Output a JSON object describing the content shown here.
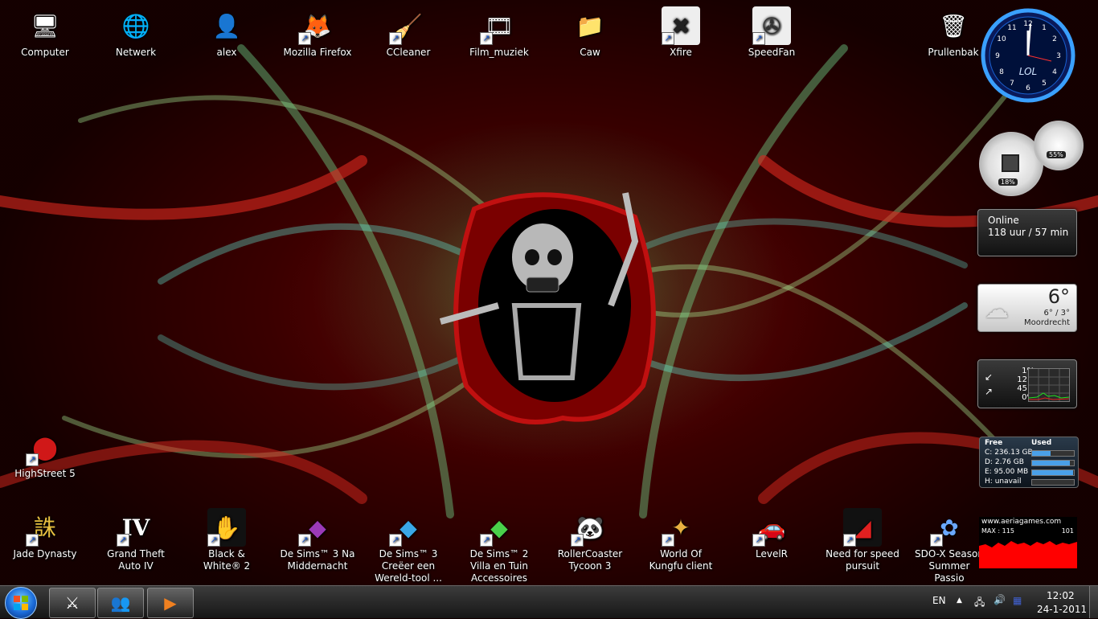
{
  "desktop": {
    "top_icons": [
      {
        "label": "Computer",
        "icon": "computer-icon",
        "glyph": "🖥",
        "shortcut": false
      },
      {
        "label": "Netwerk",
        "icon": "network-icon",
        "glyph": "🌐",
        "shortcut": false
      },
      {
        "label": "alex",
        "icon": "user-folder-icon",
        "glyph": "👤",
        "shortcut": false
      },
      {
        "label": "Mozilla Firefox",
        "icon": "firefox-icon",
        "glyph": "🦊",
        "shortcut": true
      },
      {
        "label": "CCleaner",
        "icon": "ccleaner-icon",
        "glyph": "🧹",
        "shortcut": true
      },
      {
        "label": "Film_muziek",
        "icon": "film-folder-icon",
        "glyph": "🎞",
        "shortcut": true
      },
      {
        "label": "Caw",
        "icon": "folder-icon",
        "glyph": "📁",
        "shortcut": false
      },
      {
        "label": "Xfire",
        "icon": "xfire-icon",
        "glyph": "✖",
        "shortcut": true
      },
      {
        "label": "SpeedFan",
        "icon": "speedfan-icon",
        "glyph": "✇",
        "shortcut": true
      },
      {
        "label": "Prullenbak",
        "icon": "recycle-bin-icon",
        "glyph": "🗑",
        "shortcut": false
      }
    ],
    "side_icon": {
      "label": "HighStreet 5",
      "icon": "highstreet-icon",
      "glyph": "⬤",
      "shortcut": true
    },
    "bottom_icons": [
      {
        "label": "Jade Dynasty",
        "icon": "jade-dynasty-icon",
        "glyph": "誅",
        "shortcut": true
      },
      {
        "label": "Grand Theft Auto IV",
        "icon": "gta-iv-icon",
        "glyph": "IV",
        "shortcut": true
      },
      {
        "label": "Black & White® 2",
        "icon": "black-white-2-icon",
        "glyph": "✋",
        "shortcut": true
      },
      {
        "label": "De Sims™ 3 Na Middernacht",
        "icon": "sims-3-night-icon",
        "glyph": "◆",
        "shortcut": true
      },
      {
        "label": "De Sims™ 3 Creëer een Wereld-tool ...",
        "icon": "sims-3-create-world-icon",
        "glyph": "◆",
        "shortcut": true
      },
      {
        "label": "De Sims™ 2 Villa en Tuin Accessoires",
        "icon": "sims-2-villa-icon",
        "glyph": "◆",
        "shortcut": true
      },
      {
        "label": "RollerCoaster Tycoon 3",
        "icon": "rollercoaster-icon",
        "glyph": "🐼",
        "shortcut": true
      },
      {
        "label": "World Of Kungfu client",
        "icon": "kungfu-icon",
        "glyph": "✦",
        "shortcut": true
      },
      {
        "label": "LevelR",
        "icon": "levelr-icon",
        "glyph": "🚗",
        "shortcut": true
      },
      {
        "label": "Need for speed pursuit",
        "icon": "nfs-icon",
        "glyph": "◢",
        "shortcut": true
      },
      {
        "label": "SDO-X Season Summer Passio",
        "icon": "sdo-x-icon",
        "glyph": "✿",
        "shortcut": true
      }
    ]
  },
  "gadgets": {
    "clock": {
      "label": "LOL",
      "hour_hand": 12,
      "minute_hand": 2
    },
    "cpu_meter": {
      "cpu": "18%",
      "memory": "55%"
    },
    "online": {
      "title": "Online",
      "value": "118 uur / 57 min"
    },
    "weather": {
      "temp": "6°",
      "range": "6° / 3°",
      "city": "Moordrecht"
    },
    "network": {
      "up_pct": "1%",
      "up_k": "12 k",
      "down_k": "45 k",
      "down_pct": "0%"
    },
    "drives": {
      "header_free": "Free",
      "header_used": "Used",
      "rows": [
        {
          "label": "C:",
          "value": "236.13 GB",
          "fill": 0.45
        },
        {
          "label": "D:",
          "value": "2.76 GB",
          "fill": 0.9
        },
        {
          "label": "E:",
          "value": "95.00 MB",
          "fill": 0.98
        },
        {
          "label": "H:",
          "value": "unavail",
          "fill": 0
        }
      ]
    },
    "aeria": {
      "site": "www.aeriagames.com",
      "max": "MAX : 115",
      "current": "101"
    }
  },
  "taskbar": {
    "pinned": [
      {
        "name": "game-app-icon",
        "glyph": "⚔"
      },
      {
        "name": "messenger-icon",
        "glyph": "👥"
      },
      {
        "name": "media-player-icon",
        "glyph": "▶"
      }
    ],
    "language": "EN",
    "time": "12:02",
    "date": "24-1-2011"
  },
  "colors": {
    "accent": "#1a56c8",
    "graph_red": "#ff0000"
  }
}
